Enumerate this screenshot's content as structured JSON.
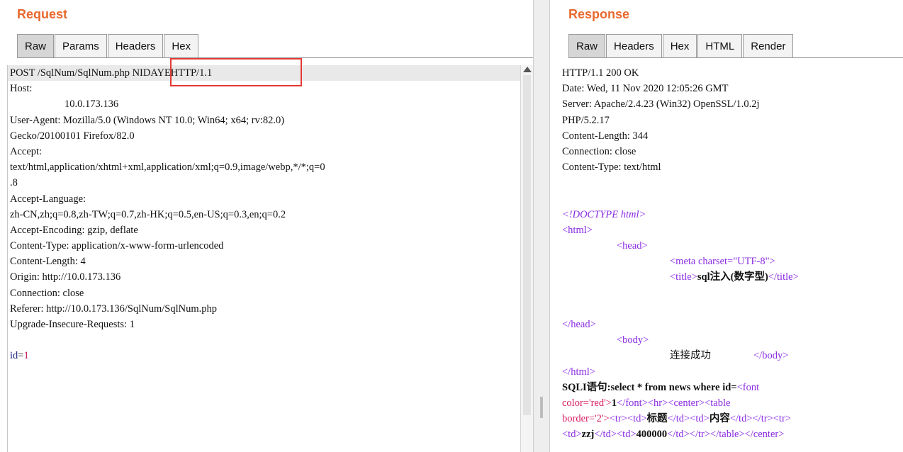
{
  "request": {
    "title": "Request",
    "tabs": [
      "Raw",
      "Params",
      "Headers",
      "Hex"
    ],
    "lines": [
      "POST /SqlNum/SqlNum.php NIDAYEHTTP/1.1",
      "Host:",
      "10.0.173.136",
      "User-Agent: Mozilla/5.0 (Windows NT 10.0; Win64; x64; rv:82.0)",
      "Gecko/20100101 Firefox/82.0",
      "Accept:",
      "text/html,application/xhtml+xml,application/xml;q=0.9,image/webp,*/*;q=0",
      ".8",
      "Accept-Language:",
      "zh-CN,zh;q=0.8,zh-TW;q=0.7,zh-HK;q=0.5,en-US;q=0.3,en;q=0.2",
      "Accept-Encoding: gzip, deflate",
      "Content-Type: application/x-www-form-urlencoded",
      "Content-Length: 4",
      "Origin: http://10.0.173.136",
      "Connection: close",
      "Referer: http://10.0.173.136/SqlNum/SqlNum.php",
      "Upgrade-Insecure-Requests: 1",
      "",
      "id=1"
    ],
    "body_param": {
      "name": "id",
      "value": "1"
    }
  },
  "response": {
    "title": "Response",
    "tabs": [
      "Raw",
      "Headers",
      "Hex",
      "HTML",
      "Render"
    ],
    "headers": [
      "HTTP/1.1 200 OK",
      "Date: Wed, 11 Nov 2020 12:05:26 GMT",
      "Server: Apache/2.4.23 (Win32) OpenSSL/1.0.2j",
      "PHP/5.2.17",
      "Content-Length: 344",
      "Connection: close",
      "Content-Type: text/html"
    ],
    "body": {
      "doctype": "<!DOCTYPE html>",
      "html_open": "<html>",
      "head_open": "<head>",
      "meta": "<meta charset=\"UTF-8\">",
      "title_open": "<title>",
      "title_text": "sql注入(数字型)",
      "title_close": "</title>",
      "head_close": "</head>",
      "body_open": "<body>",
      "body_text": "连接成功",
      "body_close": "</body>",
      "html_close": "</html>",
      "sqli_label": "SQLI语句:select * from news where id=",
      "font_open": "<font",
      "font_attr": "color='red'>",
      "font_value": "1",
      "font_close_tags": "</font><hr><center><table",
      "table_attr": "border='2'>",
      "row1_tags": "<tr><td>",
      "col1": "标题",
      "mid1": "</td><td>",
      "col2": "内容",
      "end1": "</td></tr><tr>",
      "row2_start": "<td>",
      "cell1": "zzj",
      "mid2": "</td><td>",
      "cell2": "400000",
      "end2": "</td></tr></table></center>"
    }
  },
  "colors": {
    "title": "#e8692e",
    "highlight_box": "#e53935",
    "tag": "#8a2be2",
    "attr_value": "#d81b60"
  }
}
